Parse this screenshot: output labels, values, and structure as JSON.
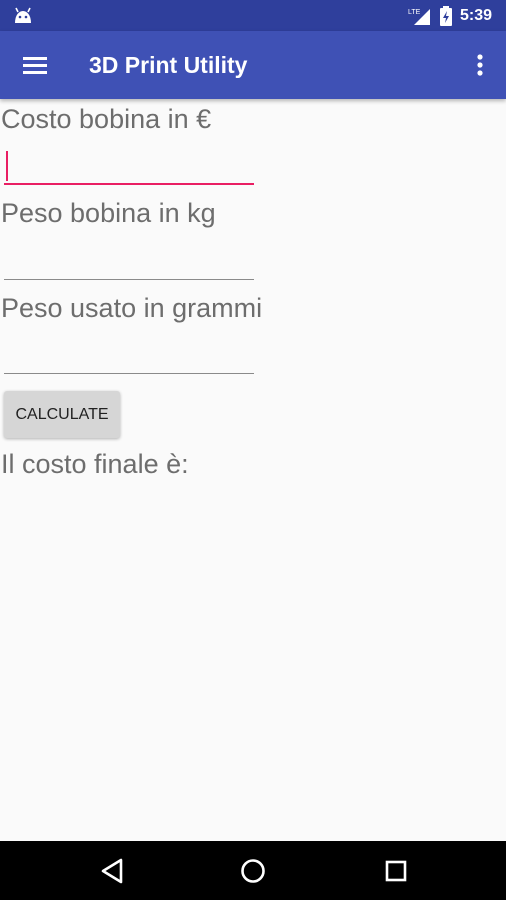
{
  "status_bar": {
    "time": "5:39",
    "network": "LTE",
    "icons": [
      "android-icon",
      "signal-icon",
      "battery-icon"
    ]
  },
  "app_bar": {
    "title": "3D Print Utility",
    "icons": [
      "menu-icon",
      "more-vert-icon"
    ]
  },
  "form": {
    "spool_cost_label": "Costo bobina in €",
    "spool_cost_value": "",
    "spool_weight_label": "Peso bobina in kg",
    "spool_weight_value": "",
    "used_weight_label": "Peso usato in grammi",
    "used_weight_value": "",
    "calculate_label": "CALCULATE",
    "result_label": "Il costo finale è:"
  },
  "nav_bar": {
    "icons": [
      "back-icon",
      "home-icon",
      "recents-icon"
    ]
  },
  "colors": {
    "status_bar": "#2f3f9c",
    "app_bar": "#3f51b5",
    "accent": "#e91e63",
    "background": "#fafafa",
    "label_text": "#6d6d6d",
    "button": "#d6d6d6",
    "nav_bar": "#000000"
  }
}
